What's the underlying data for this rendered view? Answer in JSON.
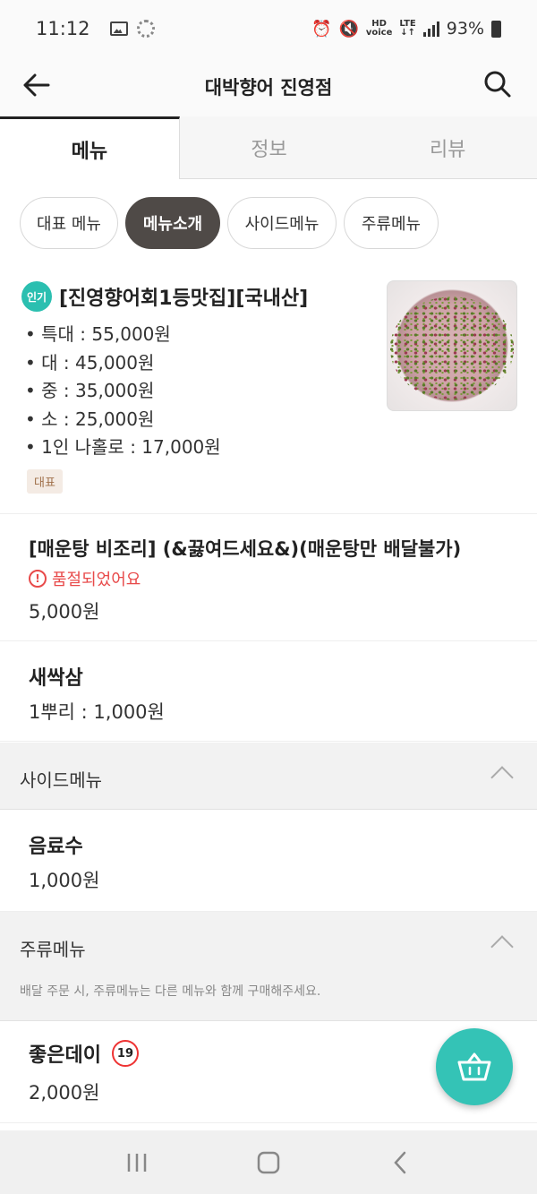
{
  "status": {
    "time": "11:12",
    "network": "LTE",
    "battery": "93%"
  },
  "header": {
    "title": "대박향어 진영점"
  },
  "tabs": [
    {
      "label": "메뉴"
    },
    {
      "label": "정보"
    },
    {
      "label": "리뷰"
    }
  ],
  "chips": [
    {
      "label": "대표 메뉴"
    },
    {
      "label": "메뉴소개"
    },
    {
      "label": "사이드메뉴"
    },
    {
      "label": "주류메뉴"
    }
  ],
  "items": {
    "hyangeo": {
      "badge": "인기",
      "name": "[진영향어회1등맛집][국내산]",
      "lines": [
        "• 특대 : 55,000원",
        "• 대 : 45,000원",
        "• 중 : 35,000원",
        "• 소 : 25,000원",
        "• 1인 나홀로 : 17,000원"
      ],
      "tag": "대표"
    },
    "maeuntang": {
      "name": "[매운탕 비조리] (&끓여드세요&)(매운탕만 배달불가)",
      "soldout": "품절되었어요",
      "price": "5,000원"
    },
    "saessak": {
      "name": "새싹삼",
      "price": "1뿌리 : 1,000원"
    },
    "drink": {
      "name": "음료수",
      "price": "1,000원"
    },
    "joeunday": {
      "name": "좋은데이",
      "age_badge": "19",
      "price": "2,000원"
    }
  },
  "sections": {
    "side": {
      "label": "사이드메뉴"
    },
    "alcohol": {
      "label": "주류메뉴",
      "note": "배달 주문 시, 주류메뉴는 다른 메뉴와 함께 구매해주세요."
    }
  },
  "colors": {
    "accent": "#34c3b6",
    "chip_active": "#4f4a47",
    "soldout": "#e84a4a"
  }
}
